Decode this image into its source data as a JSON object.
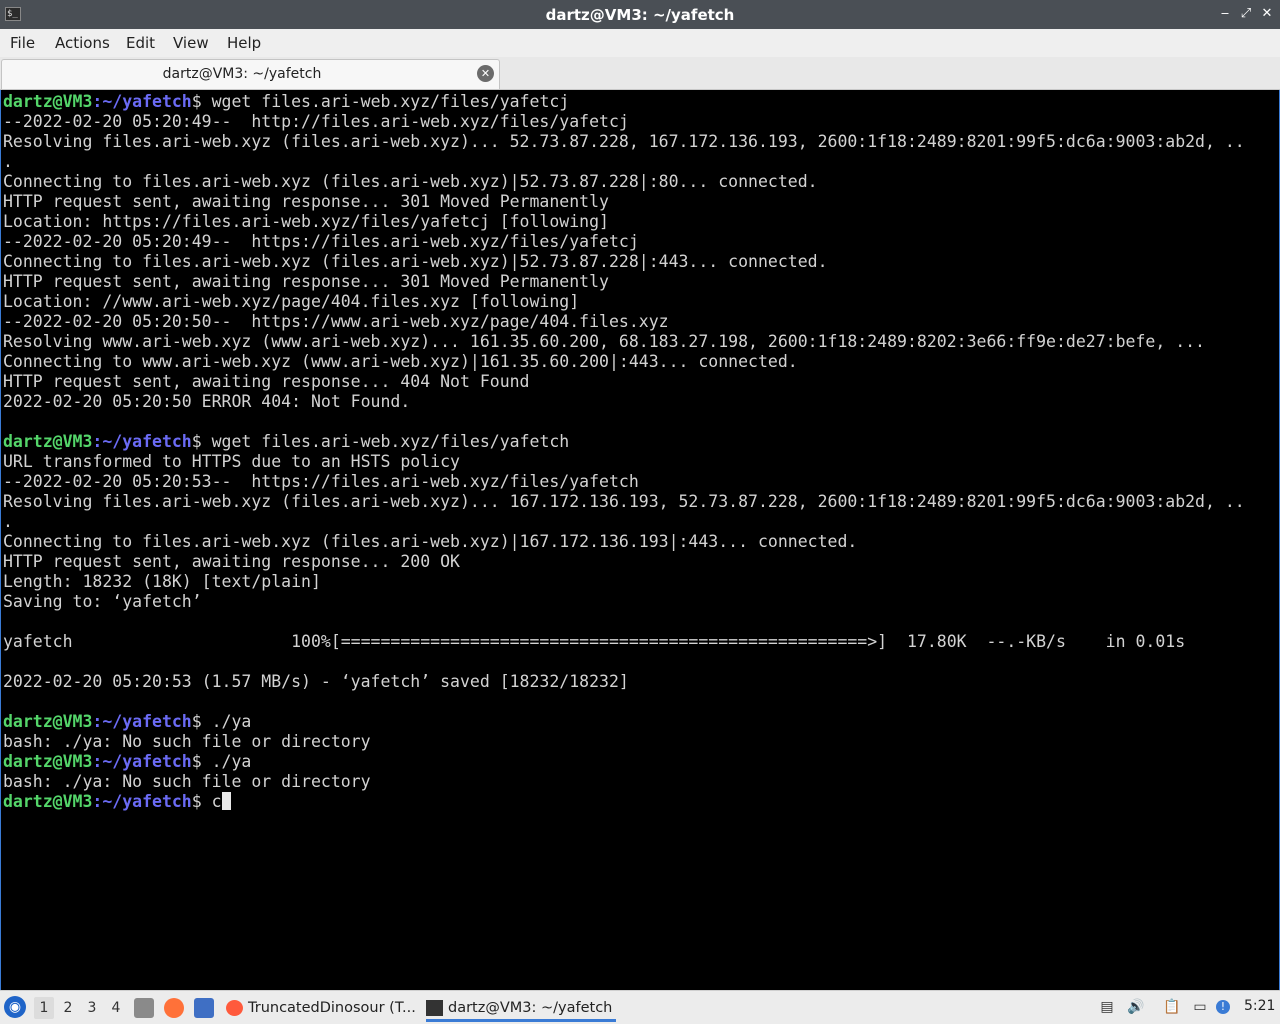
{
  "window": {
    "title": "dartz@VM3: ~/yafetch",
    "app_icon": "terminal-icon",
    "app_icon_glyph": "$_",
    "controls": {
      "minimize": "‒",
      "maximize": "⤢",
      "close": "✕"
    }
  },
  "menu": {
    "items": [
      {
        "label": "File"
      },
      {
        "label": "Actions"
      },
      {
        "label": "Edit"
      },
      {
        "label": "View"
      },
      {
        "label": "Help"
      }
    ]
  },
  "tab": {
    "label": "dartz@VM3: ~/yafetch",
    "close_glyph": "✕"
  },
  "prompt": {
    "user": "dartz@VM3",
    "path": ":~/yafetch",
    "dollar": "$ "
  },
  "terminal": {
    "lines": [
      {
        "prompt": true,
        "cmd": "wget files.ari-web.xyz/files/yafetcj"
      },
      {
        "text": "--2022-02-20 05:20:49--  http://files.ari-web.xyz/files/yafetcj"
      },
      {
        "text": "Resolving files.ari-web.xyz (files.ari-web.xyz)... 52.73.87.228, 167.172.136.193, 2600:1f18:2489:8201:99f5:dc6a:9003:ab2d, .."
      },
      {
        "text": "."
      },
      {
        "text": "Connecting to files.ari-web.xyz (files.ari-web.xyz)|52.73.87.228|:80... connected."
      },
      {
        "text": "HTTP request sent, awaiting response... 301 Moved Permanently"
      },
      {
        "text": "Location: https://files.ari-web.xyz/files/yafetcj [following]"
      },
      {
        "text": "--2022-02-20 05:20:49--  https://files.ari-web.xyz/files/yafetcj"
      },
      {
        "text": "Connecting to files.ari-web.xyz (files.ari-web.xyz)|52.73.87.228|:443... connected."
      },
      {
        "text": "HTTP request sent, awaiting response... 301 Moved Permanently"
      },
      {
        "text": "Location: //www.ari-web.xyz/page/404.files.xyz [following]"
      },
      {
        "text": "--2022-02-20 05:20:50--  https://www.ari-web.xyz/page/404.files.xyz"
      },
      {
        "text": "Resolving www.ari-web.xyz (www.ari-web.xyz)... 161.35.60.200, 68.183.27.198, 2600:1f18:2489:8202:3e66:ff9e:de27:befe, ..."
      },
      {
        "text": "Connecting to www.ari-web.xyz (www.ari-web.xyz)|161.35.60.200|:443... connected."
      },
      {
        "text": "HTTP request sent, awaiting response... 404 Not Found"
      },
      {
        "text": "2022-02-20 05:20:50 ERROR 404: Not Found."
      },
      {
        "text": ""
      },
      {
        "prompt": true,
        "cmd": "wget files.ari-web.xyz/files/yafetch"
      },
      {
        "text": "URL transformed to HTTPS due to an HSTS policy"
      },
      {
        "text": "--2022-02-20 05:20:53--  https://files.ari-web.xyz/files/yafetch"
      },
      {
        "text": "Resolving files.ari-web.xyz (files.ari-web.xyz)... 167.172.136.193, 52.73.87.228, 2600:1f18:2489:8201:99f5:dc6a:9003:ab2d, .."
      },
      {
        "text": "."
      },
      {
        "text": "Connecting to files.ari-web.xyz (files.ari-web.xyz)|167.172.136.193|:443... connected."
      },
      {
        "text": "HTTP request sent, awaiting response... 200 OK"
      },
      {
        "text": "Length: 18232 (18K) [text/plain]"
      },
      {
        "text": "Saving to: ‘yafetch’"
      },
      {
        "text": ""
      },
      {
        "text": "yafetch                      100%[=====================================================>]  17.80K  --.-KB/s    in 0.01s"
      },
      {
        "text": ""
      },
      {
        "text": "2022-02-20 05:20:53 (1.57 MB/s) - ‘yafetch’ saved [18232/18232]"
      },
      {
        "text": ""
      },
      {
        "prompt": true,
        "cmd": "./ya"
      },
      {
        "text": "bash: ./ya: No such file or directory"
      },
      {
        "prompt": true,
        "cmd": "./ya"
      },
      {
        "text": "bash: ./ya: No such file or directory"
      },
      {
        "prompt": true,
        "cmd": "c",
        "cursor": true
      }
    ]
  },
  "taskbar": {
    "start_icon": "lubuntu-logo-icon",
    "start_glyph": "◉",
    "workspaces": [
      {
        "label": "1",
        "active": true
      },
      {
        "label": "2"
      },
      {
        "label": "3"
      },
      {
        "label": "4"
      }
    ],
    "launchers": [
      {
        "name": "file-manager-icon",
        "color": "#7a7a7a"
      },
      {
        "name": "firefox-icon",
        "color": "#ff7139"
      },
      {
        "name": "show-desktop-icon",
        "color": "#3f6fc4"
      }
    ],
    "tasks": [
      {
        "label": "TruncatedDinosour (T...",
        "icon": "firefox-icon",
        "icon_color": "#ff5a3c"
      },
      {
        "label": "dartz@VM3: ~/yafetch",
        "icon": "terminal-icon",
        "icon_color": "#333333",
        "active": true
      }
    ],
    "tray": [
      {
        "name": "drive-icon",
        "glyph": "▤"
      },
      {
        "name": "volume-icon",
        "glyph": "🔊"
      },
      {
        "name": "clipboard-icon",
        "glyph": "📋"
      },
      {
        "name": "network-icon",
        "glyph": "▭"
      },
      {
        "name": "update-notifier-icon",
        "glyph": "!"
      }
    ],
    "clock": "5:21"
  },
  "colors": {
    "prompt_user": "#54d66a",
    "prompt_path": "#6b6bf5",
    "terminal_bg": "#000000",
    "terminal_fg": "#d3d3d3",
    "accent": "#3a7bd5"
  }
}
